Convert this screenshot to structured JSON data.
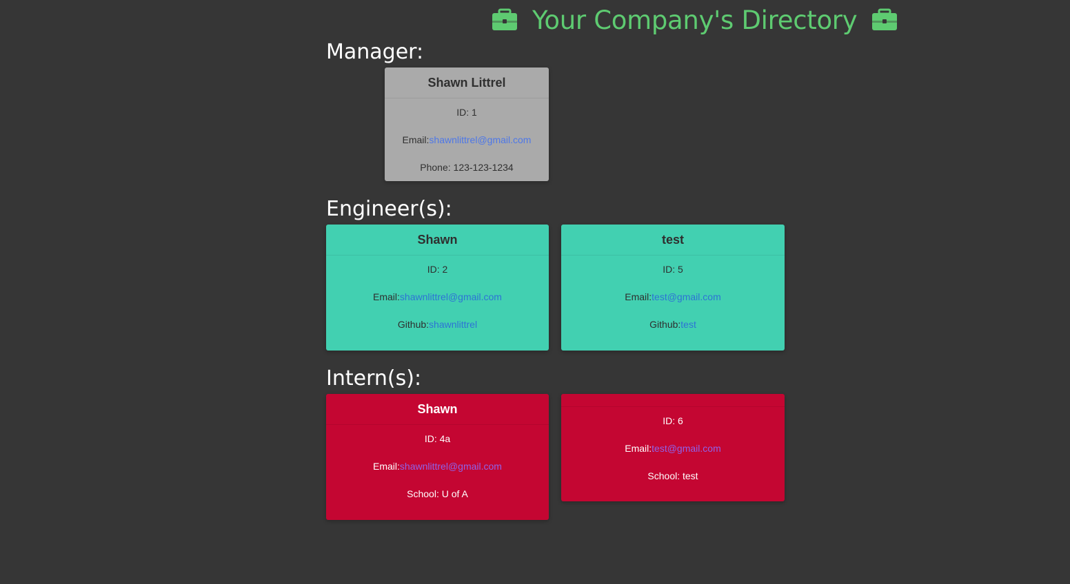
{
  "header": {
    "title": "Your Company's Directory"
  },
  "sections": {
    "manager": "Manager:",
    "engineers": "Engineer(s):",
    "interns": "Intern(s):"
  },
  "cards": {
    "manager": {
      "name": "Shawn Littrel",
      "id_label": "ID: 1",
      "email_label": "Email: ",
      "email": "shawnlittrel@gmail.com",
      "phone_label": "Phone: 123-123-1234"
    },
    "engineers": [
      {
        "name": "Shawn",
        "id_label": "ID: 2",
        "email_label": "Email: ",
        "email": "shawnlittrel@gmail.com",
        "github_label": "Github: ",
        "github": "shawnlittrel"
      },
      {
        "name": "test",
        "id_label": "ID: 5",
        "email_label": "Email: ",
        "email": "test@gmail.com",
        "github_label": "Github: ",
        "github": "test"
      }
    ],
    "interns": [
      {
        "name": "Shawn",
        "id_label": "ID: 4a",
        "email_label": "Email: ",
        "email": "shawnlittrel@gmail.com",
        "school_label": "School: U of A"
      },
      {
        "name": "",
        "id_label": "ID: 6",
        "email_label": "Email: ",
        "email": "test@gmail.com",
        "school_label": "School: test"
      }
    ]
  },
  "colors": {
    "background": "#363636",
    "header": "#5ecb71",
    "manager_card": "#aaaaaa",
    "engineer_card": "#42d0b1",
    "intern_card": "#c40632"
  },
  "icons": {
    "left": "briefcase-icon",
    "right": "briefcase-icon"
  }
}
